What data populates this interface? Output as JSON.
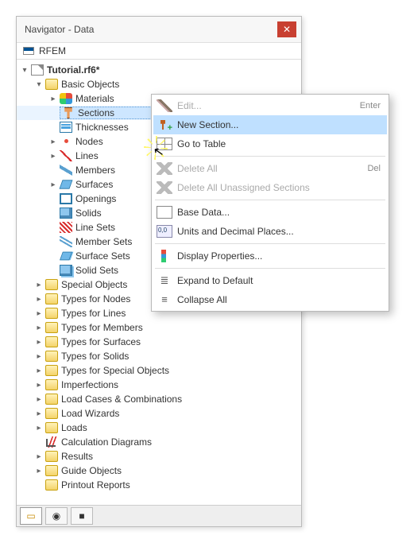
{
  "window": {
    "title": "Navigator - Data"
  },
  "app_label": "RFEM",
  "file_label": "Tutorial.rf6*",
  "basic_objects_label": "Basic Objects",
  "basic_children": {
    "materials": "Materials",
    "sections": "Sections",
    "thicknesses": "Thicknesses",
    "nodes": "Nodes",
    "lines": "Lines",
    "members": "Members",
    "surfaces": "Surfaces",
    "openings": "Openings",
    "solids": "Solids",
    "line_sets": "Line Sets",
    "member_sets": "Member Sets",
    "surface_sets": "Surface Sets",
    "solid_sets": "Solid Sets"
  },
  "folders": {
    "special_objects": "Special Objects",
    "types_for_nodes": "Types for Nodes",
    "types_for_lines": "Types for Lines",
    "types_for_members": "Types for Members",
    "types_for_surfaces": "Types for Surfaces",
    "types_for_solids": "Types for Solids",
    "types_for_special_objects": "Types for Special Objects",
    "imperfections": "Imperfections",
    "load_cases": "Load Cases & Combinations",
    "load_wizards": "Load Wizards",
    "loads": "Loads",
    "calculation_diagrams": "Calculation Diagrams",
    "results": "Results",
    "guide_objects": "Guide Objects",
    "printout_reports": "Printout Reports"
  },
  "context_menu": {
    "edit": "Edit...",
    "edit_shortcut": "Enter",
    "new_section": "New Section...",
    "go_to_table": "Go to Table",
    "delete_all": "Delete All",
    "delete_all_shortcut": "Del",
    "delete_unassigned": "Delete All Unassigned Sections",
    "base_data": "Base Data...",
    "units": "Units and Decimal Places...",
    "display_props": "Display Properties...",
    "expand": "Expand to Default",
    "collapse": "Collapse All"
  },
  "colors": {
    "highlight": "#bfe0ff"
  }
}
